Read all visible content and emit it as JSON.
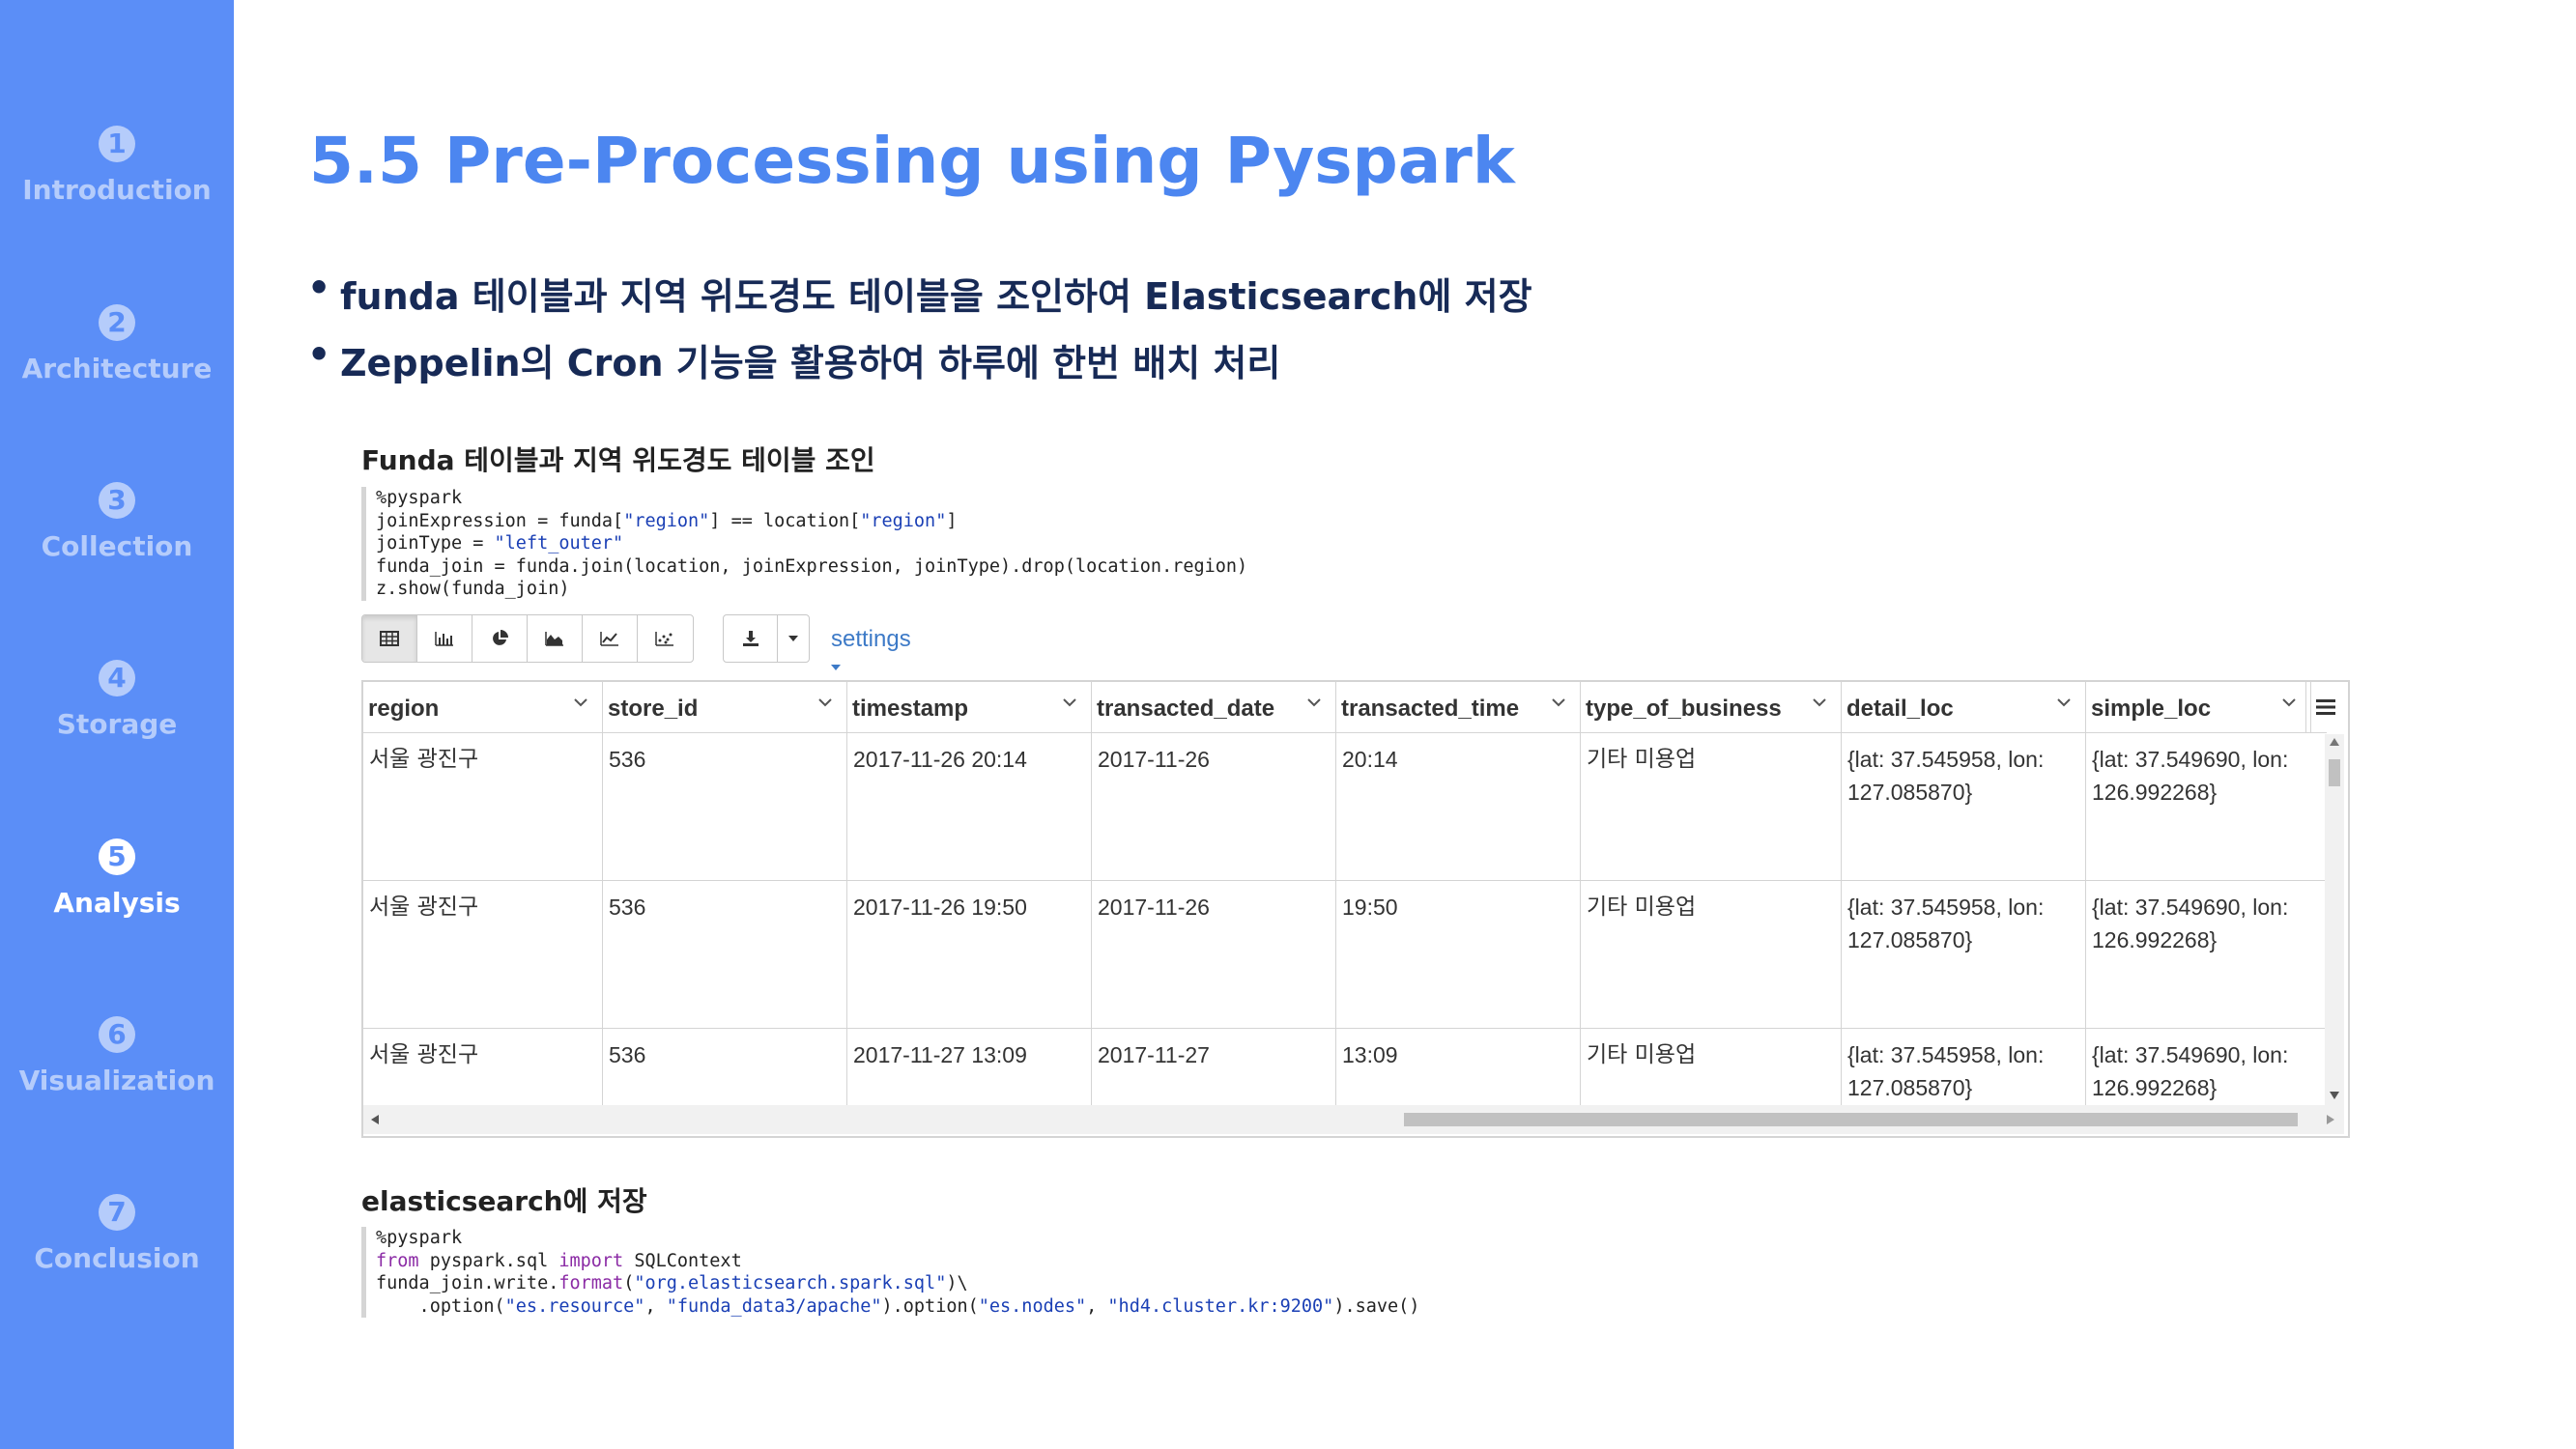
{
  "sidebar": {
    "items": [
      {
        "num": "1",
        "label": "Introduction",
        "active": false
      },
      {
        "num": "2",
        "label": "Architecture",
        "active": false
      },
      {
        "num": "3",
        "label": "Collection",
        "active": false
      },
      {
        "num": "4",
        "label": "Storage",
        "active": false
      },
      {
        "num": "5",
        "label": "Analysis",
        "active": true
      },
      {
        "num": "6",
        "label": "Visualization",
        "active": false
      },
      {
        "num": "7",
        "label": "Conclusion",
        "active": false
      }
    ]
  },
  "title": "5.5 Pre-Processing using Pyspark",
  "bullets": [
    "funda 테이블과 지역 위도경도 테이블을 조인하여 Elasticsearch에 저장",
    "Zeppelin의 Cron 기능을 활용하여 하루에 한번 배치 처리"
  ],
  "section1": {
    "heading": "Funda 테이블과 지역 위도경도 테이블 조인",
    "code": {
      "l1": "%pyspark",
      "l2a": "joinExpression = funda[",
      "l2s1": "\"region\"",
      "l2b": "] == location[",
      "l2s2": "\"region\"",
      "l2c": "]",
      "l3a": "joinType = ",
      "l3s": "\"left_outer\"",
      "l4": "funda_join = funda.join(location, joinExpression, joinType).drop(location.region)",
      "l5": "z.show(funda_join)"
    }
  },
  "toolbar": {
    "viz_buttons": [
      "table-icon",
      "bar-chart-icon",
      "pie-chart-icon",
      "area-chart-icon",
      "line-chart-icon",
      "scatter-chart-icon"
    ],
    "download_icon": "download-icon",
    "settings_label": "settings"
  },
  "table": {
    "columns": [
      "region",
      "store_id",
      "timestamp",
      "transacted_date",
      "transacted_time",
      "type_of_business",
      "detail_loc",
      "simple_loc"
    ],
    "rows": [
      {
        "region": "서울 광진구",
        "store_id": "536",
        "timestamp": "2017-11-26 20:14",
        "transacted_date": "2017-11-26",
        "transacted_time": "20:14",
        "type_of_business": "기타 미용업",
        "detail_loc": "{lat: 37.545958, lon: 127.085870}",
        "simple_loc": "{lat: 37.549690, lon: 126.992268}"
      },
      {
        "region": "서울 광진구",
        "store_id": "536",
        "timestamp": "2017-11-26 19:50",
        "transacted_date": "2017-11-26",
        "transacted_time": "19:50",
        "type_of_business": "기타 미용업",
        "detail_loc": "{lat: 37.545958, lon: 127.085870}",
        "simple_loc": "{lat: 37.549690, lon: 126.992268}"
      },
      {
        "region": "서울 광진구",
        "store_id": "536",
        "timestamp": "2017-11-27 13:09",
        "transacted_date": "2017-11-27",
        "transacted_time": "13:09",
        "type_of_business": "기타 미용업",
        "detail_loc": "{lat: 37.545958, lon: 127.085870}",
        "simple_loc": "{lat: 37.549690, lon: 126.992268}"
      }
    ]
  },
  "section2": {
    "heading": "elasticsearch에 저장",
    "code": {
      "l1": "%pyspark",
      "l2k1": "from",
      "l2a": " pyspark.sql ",
      "l2k2": "import",
      "l2b": " SQLContext",
      "l3a": "funda_join.write.",
      "l3k": "format",
      "l3b": "(",
      "l3s": "\"org.elasticsearch.spark.sql\"",
      "l3c": ")\\",
      "l4a": "    .option(",
      "l4s1": "\"es.resource\"",
      "l4b": ", ",
      "l4s2": "\"funda_data3/apache\"",
      "l4c": ").option(",
      "l4s3": "\"es.nodes\"",
      "l4d": ", ",
      "l4s4": "\"hd4.cluster.kr:9200\"",
      "l4e": ").save()"
    }
  },
  "colors": {
    "sidebar": "#5b8ef7",
    "title": "#4c86f0",
    "bullet_text": "#172a56",
    "link": "#3d7ac7"
  }
}
